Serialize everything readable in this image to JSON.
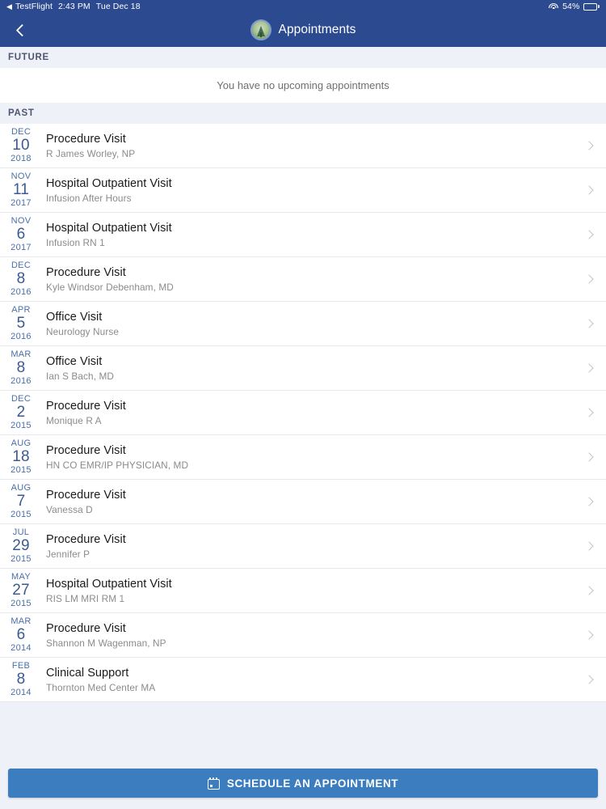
{
  "status_bar": {
    "back_app": "TestFlight",
    "back_arrow": "◀",
    "time": "2:43 PM",
    "date": "Tue Dec 18",
    "wifi_icon": "wifi-icon",
    "battery_percent": "54%",
    "battery_level": 54
  },
  "nav": {
    "back_icon": "chevron-left-icon",
    "logo_icon": "tree-logo-icon",
    "title": "Appointments"
  },
  "sections": {
    "future": {
      "header": "FUTURE",
      "empty_message": "You have no upcoming appointments"
    },
    "past": {
      "header": "PAST"
    }
  },
  "appointments": [
    {
      "month": "DEC",
      "day": "10",
      "year": "2018",
      "title": "Procedure Visit",
      "provider": "R James Worley, NP"
    },
    {
      "month": "NOV",
      "day": "11",
      "year": "2017",
      "title": "Hospital Outpatient Visit",
      "provider": "Infusion After Hours"
    },
    {
      "month": "NOV",
      "day": "6",
      "year": "2017",
      "title": "Hospital Outpatient Visit",
      "provider": "Infusion RN 1"
    },
    {
      "month": "DEC",
      "day": "8",
      "year": "2016",
      "title": "Procedure Visit",
      "provider": "Kyle Windsor Debenham, MD"
    },
    {
      "month": "APR",
      "day": "5",
      "year": "2016",
      "title": "Office Visit",
      "provider": "Neurology Nurse"
    },
    {
      "month": "MAR",
      "day": "8",
      "year": "2016",
      "title": "Office Visit",
      "provider": "Ian S Bach, MD"
    },
    {
      "month": "DEC",
      "day": "2",
      "year": "2015",
      "title": "Procedure Visit",
      "provider": "Monique R A"
    },
    {
      "month": "AUG",
      "day": "18",
      "year": "2015",
      "title": "Procedure Visit",
      "provider": "HN CO EMR/IP PHYSICIAN, MD"
    },
    {
      "month": "AUG",
      "day": "7",
      "year": "2015",
      "title": "Procedure Visit",
      "provider": "Vanessa D"
    },
    {
      "month": "JUL",
      "day": "29",
      "year": "2015",
      "title": "Procedure Visit",
      "provider": "Jennifer P"
    },
    {
      "month": "MAY",
      "day": "27",
      "year": "2015",
      "title": "Hospital Outpatient Visit",
      "provider": "RIS LM MRI RM 1"
    },
    {
      "month": "MAR",
      "day": "6",
      "year": "2014",
      "title": "Procedure Visit",
      "provider": "Shannon M Wagenman, NP"
    },
    {
      "month": "FEB",
      "day": "8",
      "year": "2014",
      "title": "Clinical Support",
      "provider": "Thornton Med Center MA"
    }
  ],
  "row_chevron_icon": "chevron-right-icon",
  "footer": {
    "cta_label": "SCHEDULE AN APPOINTMENT",
    "cta_icon": "calendar-icon"
  },
  "colors": {
    "nav_bar": "#2c4a8f",
    "section_band": "#eef1f8",
    "cta_button": "#3b7dbf",
    "date_text": "#3b5a91",
    "provider_text": "#8b8b8f"
  }
}
